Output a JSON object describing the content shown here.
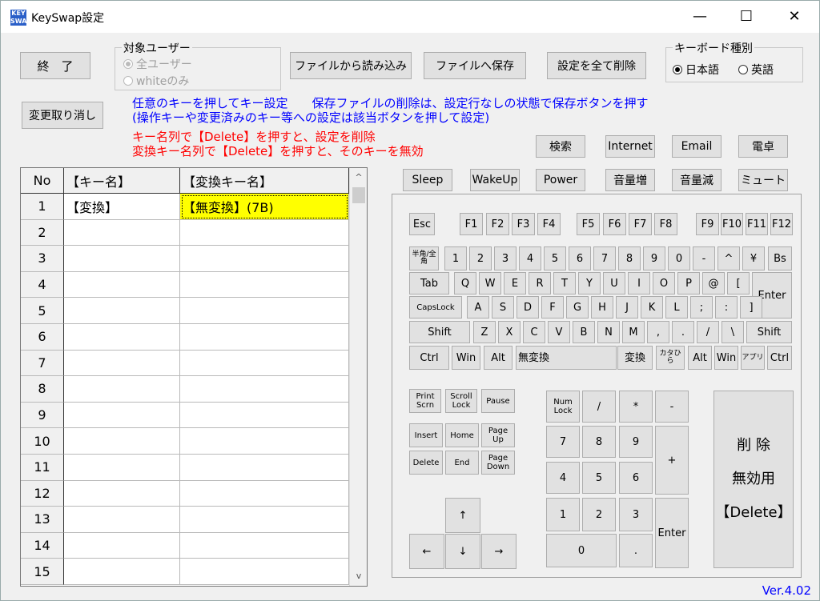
{
  "window": {
    "title": "KeySwap設定",
    "icon_text": "KEY SWAP",
    "minimize": "—",
    "maximize": "☐",
    "close": "✕"
  },
  "buttons": {
    "exit": "終　了",
    "undo": "変更取り消し",
    "load": "ファイルから読み込み",
    "save": "ファイルへ保存",
    "delete_all": "設定を全て削除"
  },
  "target_user": {
    "label": "対象ユーザー",
    "options": [
      {
        "label": "全ユーザー",
        "selected": true
      },
      {
        "label": "whiteのみ",
        "selected": false
      }
    ]
  },
  "keyboard_type": {
    "label": "キーボード種別",
    "options": [
      {
        "label": "日本語",
        "selected": true
      },
      {
        "label": "英語",
        "selected": false
      }
    ]
  },
  "info": {
    "line1": "任意のキーを押してキー設定　　保存ファイルの削除は、設定行なしの状態で保存ボタンを押す",
    "line2": "(操作キーや変更済みのキー等への設定は該当ボタンを押して設定)",
    "line3": "キー名列で【Delete】を押すと、設定を削除",
    "line4": "変換キー名列で【Delete】を押すと、そのキーを無効"
  },
  "table": {
    "headers": [
      "No",
      "【キー名】",
      "【変換キー名】"
    ],
    "rows": [
      {
        "no": "1",
        "key": "【変換】",
        "mapped": "【無変換】(7B)"
      },
      {
        "no": "2",
        "key": "",
        "mapped": ""
      },
      {
        "no": "3",
        "key": "",
        "mapped": ""
      },
      {
        "no": "4",
        "key": "",
        "mapped": ""
      },
      {
        "no": "5",
        "key": "",
        "mapped": ""
      },
      {
        "no": "6",
        "key": "",
        "mapped": ""
      },
      {
        "no": "7",
        "key": "",
        "mapped": ""
      },
      {
        "no": "8",
        "key": "",
        "mapped": ""
      },
      {
        "no": "9",
        "key": "",
        "mapped": ""
      },
      {
        "no": "10",
        "key": "",
        "mapped": ""
      },
      {
        "no": "11",
        "key": "",
        "mapped": ""
      },
      {
        "no": "12",
        "key": "",
        "mapped": ""
      },
      {
        "no": "13",
        "key": "",
        "mapped": ""
      },
      {
        "no": "14",
        "key": "",
        "mapped": ""
      },
      {
        "no": "15",
        "key": "",
        "mapped": ""
      }
    ],
    "scroll_up": "^",
    "scroll_down": "v"
  },
  "special_keys": [
    "検索",
    "Internet",
    "Email",
    "電卓",
    "Sleep",
    "WakeUp",
    "Power",
    "音量増",
    "音量減",
    "ミュート"
  ],
  "keyboard": {
    "esc": "Esc",
    "fkeys": [
      "F1",
      "F2",
      "F3",
      "F4",
      "F5",
      "F6",
      "F7",
      "F8",
      "F9",
      "F10",
      "F11",
      "F12"
    ],
    "row1": [
      "半角/全角",
      "1",
      "2",
      "3",
      "4",
      "5",
      "6",
      "7",
      "8",
      "9",
      "0",
      "-",
      "^",
      "¥",
      "Bs"
    ],
    "row2": [
      "Tab",
      "Q",
      "W",
      "E",
      "R",
      "T",
      "Y",
      "U",
      "I",
      "O",
      "P",
      "@",
      "["
    ],
    "enter": "Enter",
    "row3": [
      "CapsLock",
      "A",
      "S",
      "D",
      "F",
      "G",
      "H",
      "J",
      "K",
      "L",
      ";",
      ":",
      "]"
    ],
    "row4": [
      "Shift",
      "Z",
      "X",
      "C",
      "V",
      "B",
      "N",
      "M",
      ",",
      ".",
      "/",
      "\\",
      "Shift"
    ],
    "row5": [
      "Ctrl",
      "Win",
      "Alt",
      "無変換",
      "変換",
      "カタひら",
      "Alt",
      "Win",
      "アプリ",
      "Ctrl"
    ],
    "nav": [
      "Print Scrn",
      "Scroll Lock",
      "Pause",
      "Insert",
      "Home",
      "Page Up",
      "Delete",
      "End",
      "Page Down"
    ],
    "arrows": [
      "↑",
      "←",
      "↓",
      "→"
    ],
    "numpad": [
      "Num Lock",
      "/",
      "*",
      "-",
      "7",
      "8",
      "9",
      "+",
      "4",
      "5",
      "6",
      "1",
      "2",
      "3",
      "Enter",
      "0",
      "."
    ],
    "delete_big": [
      "削 除",
      "無効用",
      "【Delete】"
    ]
  },
  "version": "Ver.4.02"
}
